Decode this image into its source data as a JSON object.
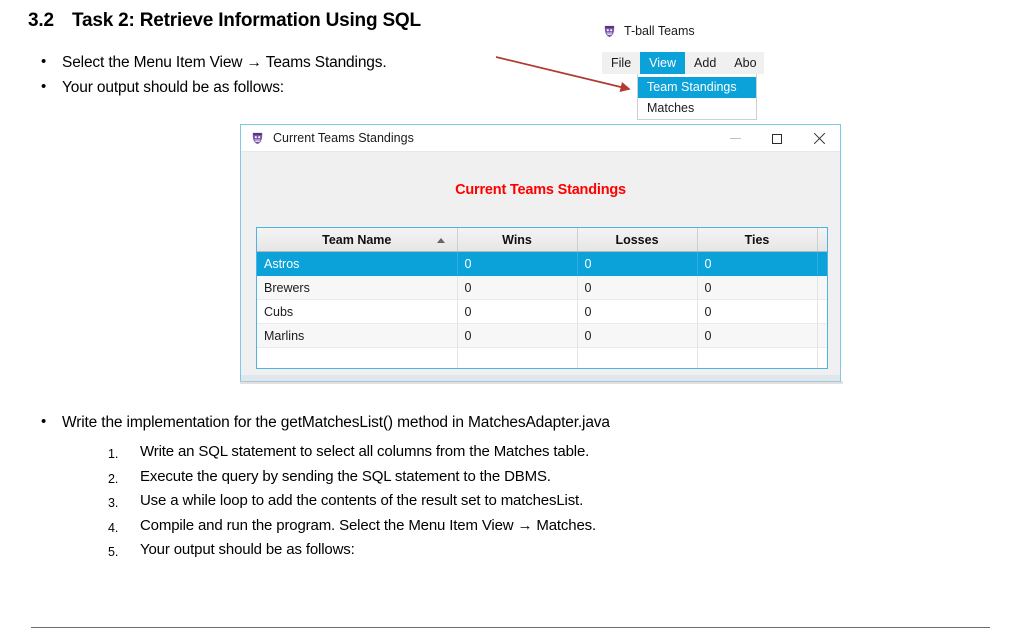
{
  "document": {
    "section_number": "3.2",
    "section_title": "Task 2: Retrieve Information Using SQL",
    "top_bullets": [
      "Select the Menu Item View → Teams Standings.",
      "Your output should be as follows:"
    ],
    "bottom_bullets": [
      "Write the implementation for the getMatchesList() method in MatchesAdapter.java"
    ],
    "numbered_steps": [
      "Write an SQL statement to select all columns from the Matches table.",
      "Execute the query by sending the SQL statement to the DBMS.",
      "Use a while loop to add the contents of the result set to matchesList.",
      "Compile and run the program. Select the Menu Item View → Matches.",
      "Your output should be as follows:"
    ]
  },
  "app_window": {
    "title": "T-ball Teams",
    "app_icon": "tball-mask-icon",
    "menubar": [
      {
        "label": "File",
        "active": false
      },
      {
        "label": "View",
        "active": true
      },
      {
        "label": "Add",
        "active": false
      },
      {
        "label": "Abo",
        "active": false
      }
    ],
    "dropdown": [
      {
        "label": "Team Standings",
        "highlighted": true
      },
      {
        "label": "Matches",
        "highlighted": false
      }
    ]
  },
  "dialog": {
    "icon": "tball-mask-icon",
    "titlebar_text": "Current Teams Standings",
    "window_controls": {
      "minimize": "minimize-icon",
      "maximize": "maximize-icon",
      "close": "close-icon"
    },
    "heading": "Current Teams Standings",
    "heading_color": "#ff0000",
    "table": {
      "columns": [
        "Team Name",
        "Wins",
        "Losses",
        "Ties"
      ],
      "sorted_column": "Team Name",
      "sort_direction": "ascending",
      "rows": [
        {
          "team": "Astros",
          "wins": "0",
          "losses": "0",
          "ties": "0",
          "selected": true
        },
        {
          "team": "Brewers",
          "wins": "0",
          "losses": "0",
          "ties": "0",
          "selected": false
        },
        {
          "team": "Cubs",
          "wins": "0",
          "losses": "0",
          "ties": "0",
          "selected": false
        },
        {
          "team": "Marlins",
          "wins": "0",
          "losses": "0",
          "ties": "0",
          "selected": false
        }
      ],
      "empty_rows": 2
    }
  },
  "annotation": {
    "arrow_color": "#b03a34",
    "target": "Team Standings"
  },
  "colors": {
    "selection_blue": "#0aa2d8",
    "dialog_border": "#7ec8e8",
    "heading_red": "#ff0000"
  }
}
